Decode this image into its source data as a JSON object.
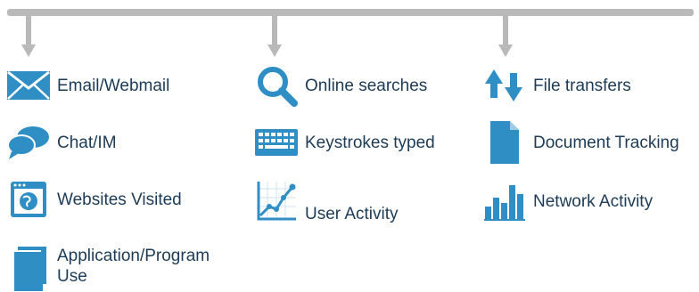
{
  "colors": {
    "icon": "#2f8fc4",
    "text": "#1c3b57",
    "connector": "#b9b9b9"
  },
  "columns": [
    {
      "items": [
        {
          "icon": "envelope-icon",
          "label": "Email/Webmail"
        },
        {
          "icon": "speech-bubbles-icon",
          "label": "Chat/IM"
        },
        {
          "icon": "browser-window-icon",
          "label": "Websites Visited"
        },
        {
          "icon": "stacked-documents-icon",
          "label": "Application/Program Use"
        }
      ]
    },
    {
      "items": [
        {
          "icon": "magnifier-icon",
          "label": "Online searches"
        },
        {
          "icon": "keyboard-icon",
          "label": "Keystrokes typed"
        },
        {
          "icon": "line-chart-icon",
          "label": "User Activity"
        }
      ]
    },
    {
      "items": [
        {
          "icon": "up-down-arrows-icon",
          "label": "File transfers"
        },
        {
          "icon": "document-icon",
          "label": "Document Tracking"
        },
        {
          "icon": "bar-chart-icon",
          "label": "Network Activity"
        }
      ]
    }
  ]
}
